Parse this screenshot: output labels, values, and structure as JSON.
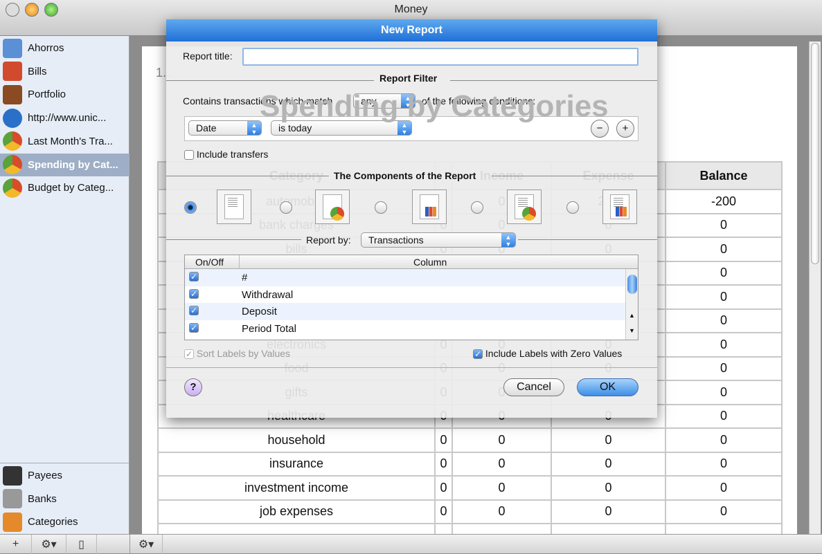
{
  "window": {
    "title": "Money"
  },
  "sidebar": {
    "items": [
      {
        "label": "Ahorros",
        "icon": "bank-account-icon",
        "color": "#5b8fd6"
      },
      {
        "label": "Bills",
        "icon": "calendar-icon",
        "color": "#d24a2e"
      },
      {
        "label": "Portfolio",
        "icon": "briefcase-icon",
        "color": "#8a4a22"
      },
      {
        "label": "http://www.unic...",
        "icon": "globe-icon",
        "color": "#2a70c8"
      },
      {
        "label": "Last Month's Tra...",
        "icon": "pie-chart-icon",
        "color": "#e0a020"
      },
      {
        "label": "Spending by Cat...",
        "icon": "pie-chart-icon",
        "color": "#e0a020",
        "selected": true
      },
      {
        "label": "Budget by Categ...",
        "icon": "pie-chart-icon",
        "color": "#e0a020"
      }
    ],
    "bottom_items": [
      {
        "label": "Payees",
        "icon": "people-icon",
        "color": "#333"
      },
      {
        "label": "Banks",
        "icon": "bank-icon",
        "color": "#999"
      },
      {
        "label": "Categories",
        "icon": "categories-icon",
        "color": "#e58a2a"
      }
    ]
  },
  "report": {
    "date": "1...",
    "title": "Spending by Categories",
    "columns": [
      "Category",
      "",
      "Income",
      "Expense",
      "Balance"
    ],
    "rows": [
      [
        "automobile",
        "0",
        "0",
        "200",
        "-200"
      ],
      [
        "bank charges",
        "0",
        "0",
        "0",
        "0"
      ],
      [
        "bills",
        "0",
        "0",
        "0",
        "0"
      ],
      [
        "",
        "0",
        "0",
        "0",
        "0"
      ],
      [
        "",
        "0",
        "0",
        "0",
        "0"
      ],
      [
        "",
        "0",
        "0",
        "0",
        "0"
      ],
      [
        "electronics",
        "0",
        "0",
        "0",
        "0"
      ],
      [
        "food",
        "0",
        "0",
        "0",
        "0"
      ],
      [
        "gifts",
        "0",
        "0",
        "0",
        "0"
      ],
      [
        "healthcare",
        "0",
        "0",
        "0",
        "0"
      ],
      [
        "household",
        "0",
        "0",
        "0",
        "0"
      ],
      [
        "insurance",
        "0",
        "0",
        "0",
        "0"
      ],
      [
        "investment income",
        "0",
        "0",
        "0",
        "0"
      ],
      [
        "job expenses",
        "0",
        "0",
        "0",
        "0"
      ],
      [
        "",
        "",
        "",
        "",
        ""
      ]
    ]
  },
  "dialog": {
    "title": "New Report",
    "report_title_label": "Report title:",
    "report_title_value": "",
    "filter_section": "Report Filter",
    "match_prefix": "Contains transactions which match",
    "match_value": "any",
    "match_suffix": "of the following conditions:",
    "condition_field": "Date",
    "condition_operator": "is today",
    "remove_label": "−",
    "add_label": "+",
    "include_transfers_label": "Include transfers",
    "include_transfers": false,
    "components_section": "The Components of the Report",
    "components": [
      {
        "icon": "text-report-icon",
        "selected": true
      },
      {
        "icon": "pie-chart-report-icon",
        "selected": false
      },
      {
        "icon": "bar-chart-report-icon",
        "selected": false
      },
      {
        "icon": "text-pie-report-icon",
        "selected": false
      },
      {
        "icon": "text-bar-report-icon",
        "selected": false
      }
    ],
    "report_by_label": "Report by:",
    "report_by_value": "Transactions",
    "list_headers": [
      "On/Off",
      "Column"
    ],
    "list_rows": [
      {
        "on": true,
        "label": "#"
      },
      {
        "on": true,
        "label": "Withdrawal"
      },
      {
        "on": true,
        "label": "Deposit"
      },
      {
        "on": true,
        "label": "Period Total"
      }
    ],
    "sort_labels": "Sort Labels by Values",
    "include_zero": "Include Labels with Zero Values",
    "help_label": "?",
    "cancel_label": "Cancel",
    "ok_label": "OK"
  },
  "colors": {
    "accent": "#3d8ee6",
    "selection": "#9eaec6",
    "sidebar": "#e6edf7"
  }
}
